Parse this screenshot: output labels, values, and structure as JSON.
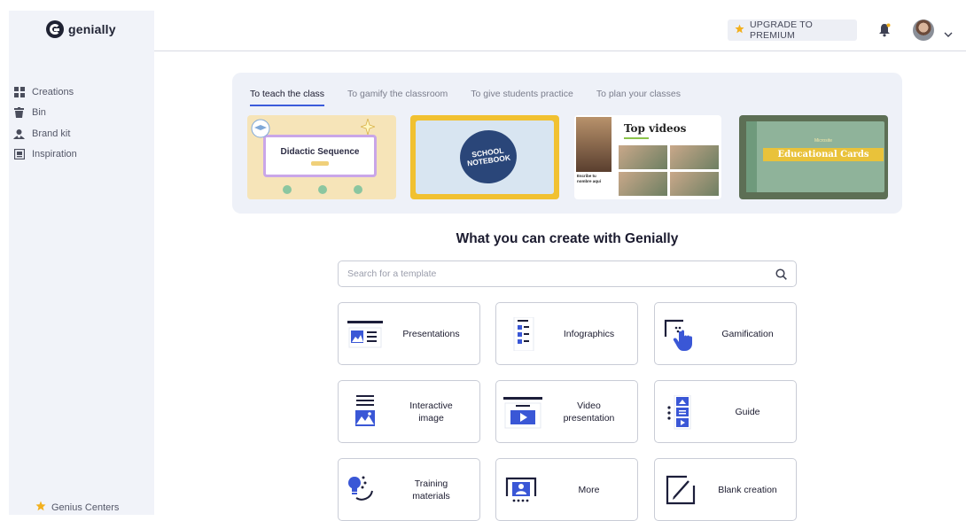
{
  "brand": {
    "name": "genially"
  },
  "sidebar": {
    "items": [
      {
        "label": "Creations",
        "icon": "grid-icon"
      },
      {
        "label": "Bin",
        "icon": "trash-icon"
      },
      {
        "label": "Brand kit",
        "icon": "brand-kit-icon"
      },
      {
        "label": "Inspiration",
        "icon": "inspiration-icon"
      }
    ],
    "footer": {
      "label": "Genius Centers",
      "icon": "star-icon"
    }
  },
  "header": {
    "upgrade_label": "UPGRADE TO PREMIUM",
    "colors": {
      "accent": "#f2b01e",
      "brand": "#3b5bdb"
    }
  },
  "templates": {
    "tabs": [
      {
        "label": "To teach the class",
        "active": true
      },
      {
        "label": "To gamify the classroom",
        "active": false
      },
      {
        "label": "To give students practice",
        "active": false
      },
      {
        "label": "To plan your classes",
        "active": false
      }
    ],
    "thumbnails": [
      {
        "title": "Didactic Sequence"
      },
      {
        "title_line1": "SCHOOL",
        "title_line2": "NOTEBOOK"
      },
      {
        "title": "Top videos",
        "caption_line1": "Escribe tu",
        "caption_line2": "nombre aquí"
      },
      {
        "kicker": "Microsite",
        "title": "Educational Cards"
      }
    ]
  },
  "create": {
    "heading": "What you can create with Genially",
    "search": {
      "placeholder": "Search for a template",
      "value": ""
    },
    "cards": [
      {
        "label": "Presentations",
        "icon": "presentation-icon"
      },
      {
        "label": "Infographics",
        "icon": "infographic-icon"
      },
      {
        "label": "Gamification",
        "icon": "gamification-icon"
      },
      {
        "label_line1": "Interactive",
        "label_line2": "image",
        "icon": "interactive-image-icon"
      },
      {
        "label_line1": "Video",
        "label_line2": "presentation",
        "icon": "video-presentation-icon"
      },
      {
        "label": "Guide",
        "icon": "guide-icon"
      },
      {
        "label_line1": "Training",
        "label_line2": "materials",
        "icon": "training-materials-icon"
      },
      {
        "label": "More",
        "icon": "more-icon"
      },
      {
        "label": "Blank creation",
        "icon": "blank-creation-icon"
      }
    ]
  }
}
